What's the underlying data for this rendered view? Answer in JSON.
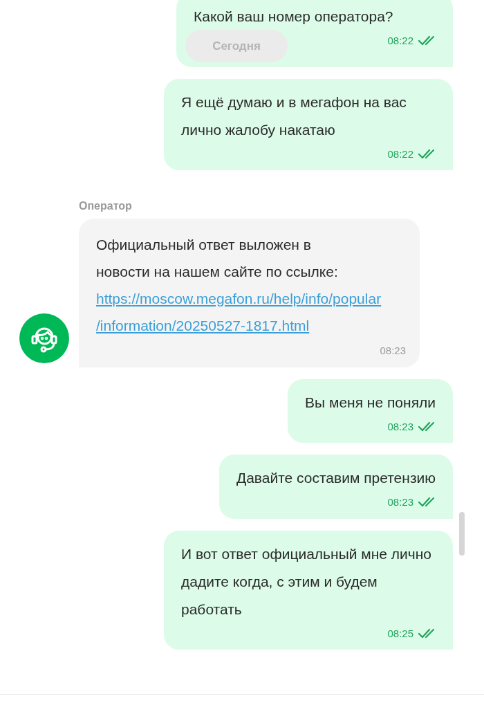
{
  "date_chip": "Сегодня",
  "messages": [
    {
      "kind": "outgoing",
      "text": "Какой ваш номер оператора?",
      "time": "08:22",
      "read": true
    },
    {
      "kind": "outgoing",
      "text": "Я ещё думаю и в мегафон на вас лично жалобу накатаю",
      "time": "08:22",
      "read": true
    },
    {
      "kind": "incoming",
      "sender": "Оператор",
      "text": "Официальный ответ выложен в новости на нашем сайте по ссылке:",
      "link": "https://moscow.megafon.ru/help/info/popular/information/20250527-1817.html",
      "time": "08:23"
    },
    {
      "kind": "outgoing",
      "text": "Вы меня не поняли",
      "time": "08:23",
      "read": true
    },
    {
      "kind": "outgoing",
      "text": "Давайте составим претензию",
      "time": "08:23",
      "read": true
    },
    {
      "kind": "outgoing",
      "text": "И вот ответ официальный мне лично дадите когда, с этим и будем работать",
      "time": "08:25",
      "read": true
    }
  ]
}
